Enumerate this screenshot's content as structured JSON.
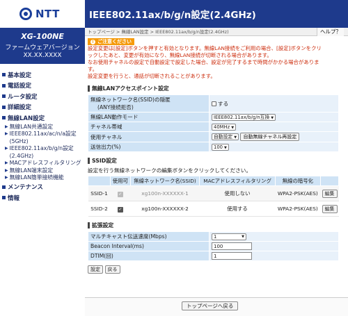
{
  "brand": {
    "logo_text": "NTT",
    "model": "XG-100NE",
    "fw_label": "ファームウェアバージョン",
    "fw_version": "XX.XX.XXXX"
  },
  "nav": [
    {
      "label": "基本設定"
    },
    {
      "label": "電話設定"
    },
    {
      "label": "ルータ設定"
    },
    {
      "label": "詳細設定"
    },
    {
      "label": "無線LAN設定",
      "subs": [
        "無線LAN共通設定",
        "IEEE802.11ax/ac/n/a設定 (5GHz)",
        "IEEE802.11ax/b/g/n設定 (2.4GHz)",
        "MACアドレスフィルタリング",
        "無線LAN端末設定",
        "無線LAN簡単接続機能"
      ]
    },
    {
      "label": "メンテナンス"
    },
    {
      "label": "情報"
    }
  ],
  "header": {
    "title": "IEEE802.11ax/b/g/n設定(2.4GHz)"
  },
  "breadcrumb": "トップページ > 無線LAN設定 > IEEE802.11ax/b/g/n設定(2.4GHz)",
  "help_label": "ヘルプ？",
  "notice": {
    "label": "ご注意ください",
    "lines": [
      "設定変更は[設定]ボタンを押すと有効となります。無線LAN接続をご利用の場合、[設定]ボタンをクリ",
      "ックしたあと、変更が有効になり、無線LAN接続が切断される場合があります。",
      "なお使用チャネルの設定で自動設定で設定した場合、設定が完了するまで時間がかかる場合がありま",
      "す。",
      "設定変更を行うと、通話が切断されることがあります。"
    ]
  },
  "ap_section": {
    "title": "無線LANアクセスポイント設定",
    "hide_ssid_label": "無線ネットワーク名(SSID)の隠匿",
    "hide_ssid_sub": "(ANY接続拒否)",
    "hide_ssid_check": "する",
    "mode_label": "無線LAN動作モード",
    "mode_value": "IEEE802.11ax/b/g/n互換",
    "bandwidth_label": "チャネル帯域",
    "bandwidth_value": "40MHz",
    "channel_label": "使用チャネル",
    "channel_value": "自動設定",
    "channel_reset_button": "自動無線チャネル再設定",
    "power_label": "送信出力(%)",
    "power_value": "100"
  },
  "ssid_section": {
    "title": "SSID設定",
    "description": "設定を行う無線ネットワークの編集ボタンをクリックしてください。",
    "headers": [
      "",
      "使用可",
      "無線ネットワーク名(SSID)",
      "MACアドレスフィルタリング",
      "無線の暗号化",
      ""
    ],
    "rows": [
      {
        "id": "SSID-1",
        "name": "xg100n-XXXXXX-1",
        "mac": "使用しない",
        "enc": "WPA2-PSK(AES)",
        "edit": "編集"
      },
      {
        "id": "SSID-2",
        "name": "xg100n-XXXXXX-2",
        "mac": "使用する",
        "enc": "WPA2-PSK(AES)",
        "edit": "編集"
      }
    ]
  },
  "ext_section": {
    "title": "拡張設定",
    "multicast_label": "マルチキャスト伝送速度(Mbps)",
    "multicast_value": "1",
    "beacon_label": "Beacon Interval(ms)",
    "beacon_value": "100",
    "dtim_label": "DTIM(回)",
    "dtim_value": "1"
  },
  "buttons": {
    "set": "設定",
    "back": "戻る",
    "top": "トップページへ戻る"
  }
}
